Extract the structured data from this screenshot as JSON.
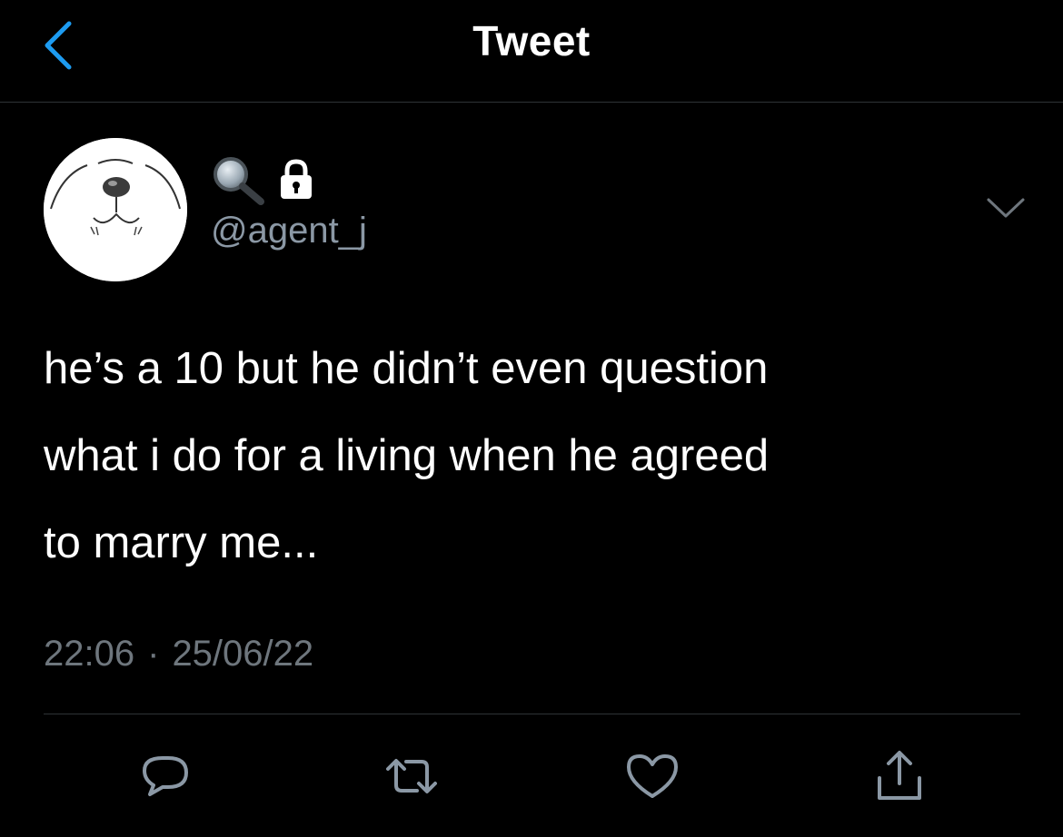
{
  "header": {
    "title": "Tweet",
    "back_icon": "chevron-left-icon",
    "accent_color": "#1d9bf0"
  },
  "tweet": {
    "display_name_icons": [
      "magnifying-glass-icon",
      "lock-icon"
    ],
    "handle": "@agent_j",
    "text_lines": [
      "he’s a 10 but he didn’t even question",
      "what i do for a living when he agreed",
      "to marry me..."
    ],
    "time": "22:06",
    "separator": "·",
    "date": "25/06/22"
  },
  "actions": {
    "reply_icon": "reply-icon",
    "retweet_icon": "retweet-icon",
    "like_icon": "heart-icon",
    "share_icon": "share-icon"
  },
  "colors": {
    "background": "#000000",
    "text": "#ffffff",
    "secondary_text": "#8b98a5",
    "divider": "#2f3336"
  }
}
